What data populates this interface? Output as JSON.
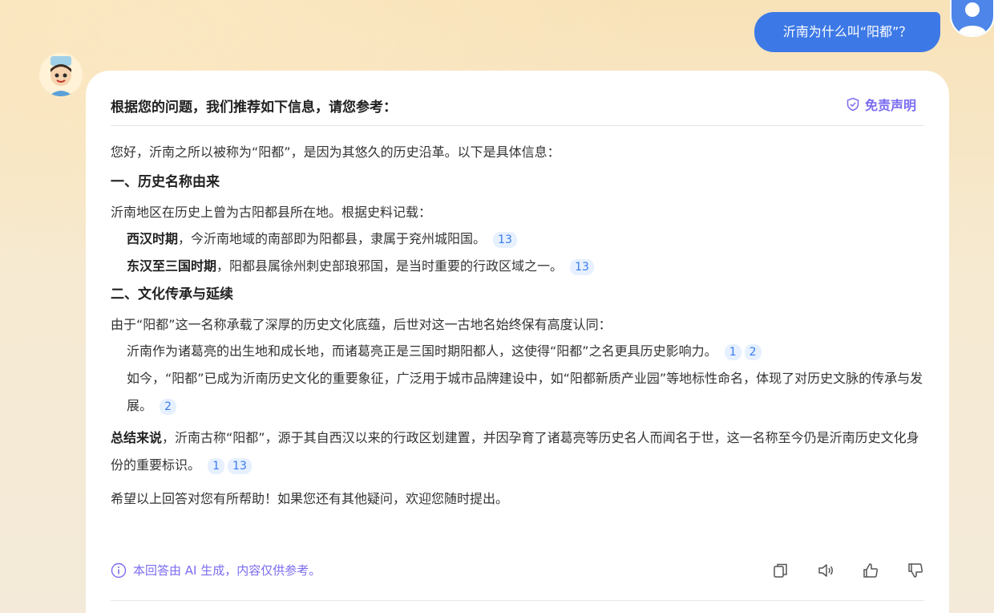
{
  "user": {
    "question": "沂南为什么叫“阳都”？"
  },
  "card": {
    "header_title": "根据您的问题，我们推荐如下信息，请您参考：",
    "disclaimer_label": "免责声明",
    "intro": "您好，沂南之所以被称为“阳都”，是因为其悠久的历史沿革。以下是具体信息：",
    "section1": {
      "heading": "一、历史名称由来",
      "lead": "沂南地区在历史上曾为古阳都县所在地。根据史料记载：",
      "items": [
        {
          "bold": "西汉时期",
          "text": "，今沂南地域的南部即为阳都县，隶属于兖州城阳国。",
          "cites": [
            "13"
          ]
        },
        {
          "bold": "东汉至三国时期",
          "text": "，阳都县属徐州刺史部琅邪国，是当时重要的行政区域之一。",
          "cites": [
            "13"
          ]
        }
      ]
    },
    "section2": {
      "heading": "二、文化传承与延续",
      "lead": "由于“阳都”这一名称承载了深厚的历史文化底蕴，后世对这一古地名始终保有高度认同：",
      "items": [
        {
          "text": "沂南作为诸葛亮的出生地和成长地，而诸葛亮正是三国时期阳都人，这使得“阳都”之名更具历史影响力。",
          "cites": [
            "1",
            "2"
          ]
        },
        {
          "text": "如今，“阳都”已成为沂南历史文化的重要象征，广泛用于城市品牌建设中，如“阳都新质产业园”等地标性命名，体现了对历史文脉的传承与发展。",
          "cites": [
            "2"
          ]
        }
      ]
    },
    "summary": {
      "bold": "总结来说",
      "text": "，沂南古称“阳都”，源于其自西汉以来的行政区划建置，并因孕育了诸葛亮等历史名人而闻名于世，这一名称至今仍是沂南历史文化身份的重要标识。",
      "cites": [
        "1",
        "13"
      ]
    },
    "closing": "希望以上回答对您有所帮助！如果您还有其他疑问，欢迎您随时提出。",
    "ai_note": "本回答由 AI 生成，内容仅供参考。",
    "actions": [
      "copy-icon",
      "speaker-icon",
      "thumbs-up-icon",
      "thumbs-down-icon"
    ]
  },
  "colors": {
    "accent": "#3d79e6",
    "purple": "#7b6cf0",
    "cite_bg": "#e6f0ff",
    "cite_text": "#3a7cf0"
  }
}
